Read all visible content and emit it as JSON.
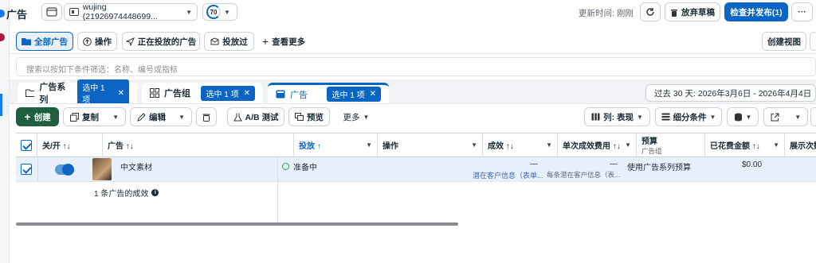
{
  "header": {
    "title": "广告",
    "account_name": "wujing (21926974448699...",
    "score": "70",
    "updated_label": "更新时间: 刚刚",
    "discard_label": "放弃草稿",
    "publish_label": "检查并发布(1)",
    "more_label": "···"
  },
  "toolbar": {
    "all_ads": "全部广告",
    "actions": "操作",
    "delivering": "正在投放的广告",
    "delivered": "投放过",
    "see_more": "查看更多",
    "create_view": "创建视图"
  },
  "search": {
    "placeholder": "搜索以按如下条件筛选：名称、编号或指标"
  },
  "tabs": [
    {
      "label": "广告系列",
      "chip": "选中 1 项"
    },
    {
      "label": "广告组",
      "chip": "选中 1 项"
    },
    {
      "label": "广告",
      "chip": "选中 1 项"
    }
  ],
  "date_range": "过去 30 天: 2026年3月6日 - 2026年4月4日",
  "actions": {
    "create": "创建",
    "copy": "复制",
    "edit": "编辑",
    "ab_test": "A/B 测试",
    "preview": "预览",
    "more": "更多",
    "columns": "列: 表现",
    "breakdown": "细分条件"
  },
  "table": {
    "headers": {
      "onoff": "关/开 ↑↓",
      "ad": "广告 ↑↓",
      "delivery": "投放 ↑",
      "action": "操作",
      "results": "成效 ↑↓",
      "cost_per": "单次成效费用 ↑↓",
      "budget": "预算",
      "budget_sub": "广告组",
      "spent": "已花费金额 ↑↓",
      "impressions": "展示次数 ↑↓"
    },
    "row": {
      "name": "中文素材",
      "delivery": "准备中",
      "results": "—",
      "results_sub": "潜在客户信息（表单...",
      "cost_per": "—",
      "cost_sub": "每条潜在客户信息（表...",
      "budget": "使用广告系列预算",
      "spent": "$0.00"
    },
    "summary": "1 条广告的成效"
  }
}
